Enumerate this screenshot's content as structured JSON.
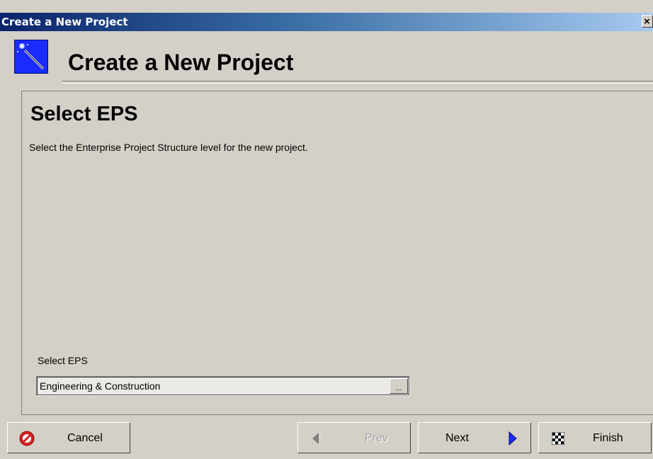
{
  "window": {
    "title": "Create a New Project",
    "close_label": "×"
  },
  "header": {
    "title": "Create a New Project",
    "icon": "magic-wand-icon"
  },
  "step": {
    "title": "Select EPS",
    "description": "Select the Enterprise Project Structure level for the new project."
  },
  "eps": {
    "label": "Select EPS",
    "value": "Engineering & Construction",
    "browse_label": "..."
  },
  "buttons": {
    "cancel": "Cancel",
    "prev": "Prev",
    "next": "Next",
    "finish": "Finish"
  },
  "icons": {
    "cancel": "no-entry-icon",
    "prev": "left-arrow-icon",
    "next": "right-arrow-icon",
    "finish": "checkered-flag-icon"
  },
  "colors": {
    "titlebar_start": "#0a246a",
    "titlebar_end": "#a6caf0",
    "dialog_bg": "#d4d0c8",
    "accent_blue": "#1a2cff",
    "cancel_red": "#d62020"
  }
}
